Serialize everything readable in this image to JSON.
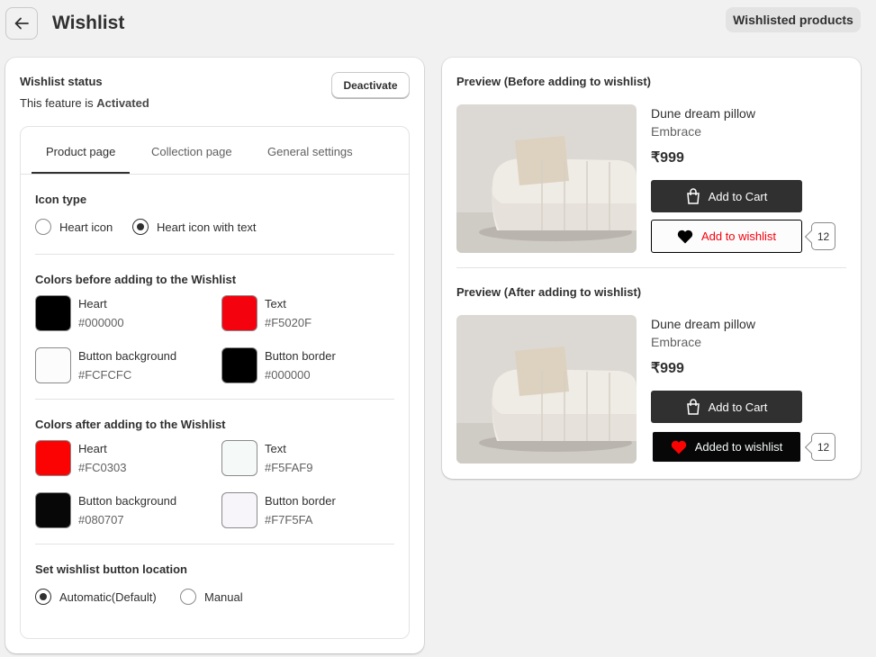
{
  "header": {
    "title": "Wishlist",
    "wishlisted_products": "Wishlisted products"
  },
  "status": {
    "title": "Wishlist status",
    "text_prefix": "This feature is ",
    "state": "Activated",
    "deactivate": "Deactivate"
  },
  "tabs": [
    {
      "label": "Product page",
      "active": true
    },
    {
      "label": "Collection page",
      "active": false
    },
    {
      "label": "General settings",
      "active": false
    }
  ],
  "icon_type": {
    "title": "Icon type",
    "options": [
      {
        "label": "Heart icon",
        "selected": false
      },
      {
        "label": "Heart icon with text",
        "selected": true
      }
    ]
  },
  "colors_before": {
    "title": "Colors before adding to the Wishlist",
    "items": [
      {
        "name": "Heart",
        "hex": "#000000"
      },
      {
        "name": "Text",
        "hex": "#F5020F"
      },
      {
        "name": "Button background",
        "hex": "#FCFCFC"
      },
      {
        "name": "Button border",
        "hex": "#000000"
      }
    ]
  },
  "colors_after": {
    "title": "Colors after adding to the Wishlist",
    "items": [
      {
        "name": "Heart",
        "hex": "#FC0303"
      },
      {
        "name": "Text",
        "hex": "#F5FAF9"
      },
      {
        "name": "Button background",
        "hex": "#080707"
      },
      {
        "name": "Button border",
        "hex": "#F7F5FA"
      }
    ]
  },
  "location": {
    "title": "Set wishlist button location",
    "options": [
      {
        "label": "Automatic(Default)",
        "selected": true
      },
      {
        "label": "Manual",
        "selected": false
      }
    ]
  },
  "preview_before": {
    "title": "Preview (Before adding to wishlist)",
    "product": "Dune dream pillow",
    "brand": "Embrace",
    "price": "₹999",
    "cart_label": "Add to Cart",
    "wish_label": "Add to wishlist",
    "count": "12"
  },
  "preview_after": {
    "title": "Preview (After adding to wishlist)",
    "product": "Dune dream pillow",
    "brand": "Embrace",
    "price": "₹999",
    "cart_label": "Add to Cart",
    "wish_label": "Added to wishlist",
    "count": "12"
  },
  "icons": [
    "arrow-left-icon",
    "shopping-bag-icon",
    "heart-icon"
  ]
}
